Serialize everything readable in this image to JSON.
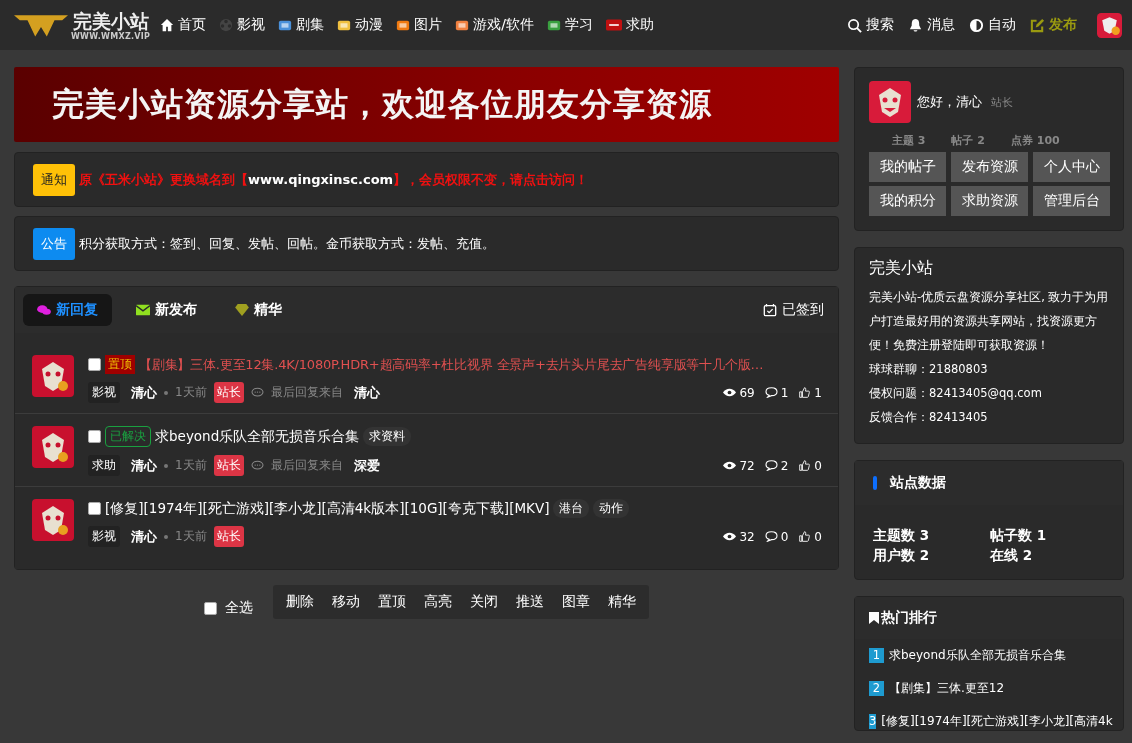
{
  "header": {
    "logo": {
      "name": "完美小站",
      "url": "WWW.WMXZ.VIP"
    },
    "nav": [
      {
        "label": "首页"
      },
      {
        "label": "影视"
      },
      {
        "label": "剧集"
      },
      {
        "label": "动漫"
      },
      {
        "label": "图片"
      },
      {
        "label": "游戏/软件"
      },
      {
        "label": "学习"
      },
      {
        "label": "求助"
      }
    ],
    "actions": [
      {
        "label": "搜索"
      },
      {
        "label": "消息"
      },
      {
        "label": "自动"
      },
      {
        "label": "发布"
      }
    ]
  },
  "banner": {
    "text": "完美小站资源分享站，欢迎各位朋友分享资源"
  },
  "notice": {
    "badge": "通知",
    "before": "原《五米小站》更换域名到【",
    "link": "www.qingxinsc.com",
    "after": "】，会员权限不变，请点击访问！"
  },
  "announcement": {
    "badge": "公告",
    "text": "积分获取方式：签到、回复、发帖、回帖。金币获取方式：发帖、充值。"
  },
  "tabs": [
    {
      "label": "新回复",
      "selected": true
    },
    {
      "label": "新发布",
      "selected": false
    },
    {
      "label": "精华",
      "selected": false
    }
  ],
  "checkin": "已签到",
  "threads": [
    {
      "checked": false,
      "badge": {
        "kind": "pinned",
        "text": "置顶"
      },
      "title": "【剧集】三体.更至12集.4K/1080P.HDR+超高码率+杜比视界 全景声+去片头片尾去广告纯享版等十几个版…",
      "highlighted": true,
      "forum": "影视",
      "author": "清心",
      "time": "1天前",
      "role": "站长",
      "last_reply_label": "最后回复来自",
      "last_reply_user": "清心",
      "views": "69",
      "replies": "1",
      "likes": "1"
    },
    {
      "checked": false,
      "badge": {
        "kind": "solved",
        "text": "已解决"
      },
      "title": "求beyond乐队全部无损音乐合集",
      "highlighted": false,
      "tags": [
        "求资料"
      ],
      "forum": "求助",
      "author": "清心",
      "time": "1天前",
      "role": "站长",
      "last_reply_label": "最后回复来自",
      "last_reply_user": "深爱",
      "views": "72",
      "replies": "2",
      "likes": "0"
    },
    {
      "checked": false,
      "title": "[修复][1974年][死亡游戏][李小龙][高清4k版本][10G][夸克下载][MKV]",
      "highlighted": false,
      "tags": [
        "港台",
        "动作"
      ],
      "forum": "影视",
      "author": "清心",
      "time": "1天前",
      "role": "站长",
      "views": "32",
      "replies": "0",
      "likes": "0"
    }
  ],
  "moderation": {
    "select_all": {
      "label": "全选",
      "checked": false
    },
    "actions": [
      "删除",
      "移动",
      "置顶",
      "高亮",
      "关闭",
      "推送",
      "图章",
      "精华"
    ]
  },
  "user_card": {
    "greeting": "您好，清心",
    "role": "站长",
    "stats": [
      "主题 3",
      "帖子 2",
      "点券 100"
    ],
    "buttons": [
      "我的帖子",
      "发布资源",
      "个人中心",
      "我的积分",
      "求助资源",
      "管理后台"
    ]
  },
  "about": {
    "title": "完美小站",
    "description": "完美小站-优质云盘资源分享社区, 致力于为用户打造最好用的资源共享网站，找资源更方便！免费注册登陆即可获取资源！",
    "lines": [
      "球球群聊：21880803",
      "侵权问题：82413405@qq.com",
      "反馈合作：82413405"
    ]
  },
  "site_stats": {
    "title": "站点数据",
    "items": [
      "主题数 3",
      "帖子数 1",
      "用户数 2",
      "在线 2"
    ]
  },
  "hot": {
    "title": "热门排行",
    "items": [
      {
        "rank": "1",
        "title": "求beyond乐队全部无损音乐合集"
      },
      {
        "rank": "2",
        "title": "【剧集】三体.更至12"
      },
      {
        "rank": "3",
        "title": "[修复][1974年][死亡游戏][李小龙][高清4k"
      }
    ]
  }
}
